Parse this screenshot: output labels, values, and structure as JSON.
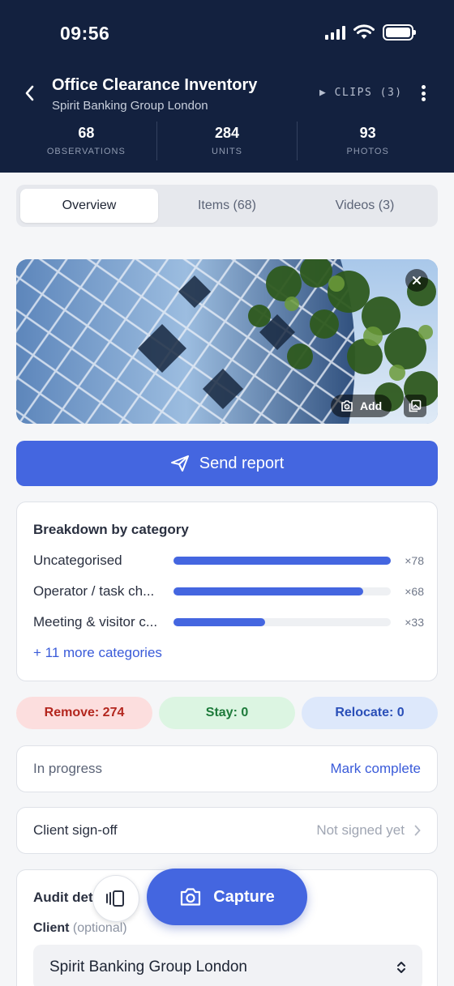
{
  "status_bar": {
    "time": "09:56"
  },
  "header": {
    "title": "Office Clearance Inventory",
    "subtitle": "Spirit Banking Group London",
    "clips_label": "CLIPS (3)",
    "stats": [
      {
        "value": "68",
        "label": "OBSERVATIONS"
      },
      {
        "value": "284",
        "label": "UNITS"
      },
      {
        "value": "93",
        "label": "PHOTOS"
      }
    ]
  },
  "tabs": [
    {
      "label": "Overview",
      "active": true
    },
    {
      "label": "Items (68)",
      "active": false
    },
    {
      "label": "Videos (3)",
      "active": false
    }
  ],
  "photo": {
    "add_label": "Add"
  },
  "send_report_label": "Send report",
  "breakdown": {
    "title": "Breakdown by category",
    "categories": [
      {
        "label": "Uncategorised",
        "count_label": "×78",
        "count": 78
      },
      {
        "label": "Operator / task ch...",
        "count_label": "×68",
        "count": 68
      },
      {
        "label": "Meeting & visitor c...",
        "count_label": "×33",
        "count": 33
      }
    ],
    "max": 78,
    "more_label": "+ 11 more categories"
  },
  "dispositions": {
    "remove": "Remove: 274",
    "stay": "Stay: 0",
    "relocate": "Relocate: 0"
  },
  "progress": {
    "status": "In progress",
    "action": "Mark complete"
  },
  "signoff": {
    "label": "Client sign-off",
    "value": "Not signed yet"
  },
  "audit": {
    "title": "Audit det",
    "client_label": "Client",
    "client_optional": "(optional)",
    "client_value": "Spirit Banking Group London"
  },
  "capture_label": "Capture",
  "colors": {
    "header_bg": "#13213f",
    "accent": "#4466e0",
    "remove": "#b3261e",
    "stay": "#1d7a3a",
    "relocate": "#2a4fb8"
  }
}
